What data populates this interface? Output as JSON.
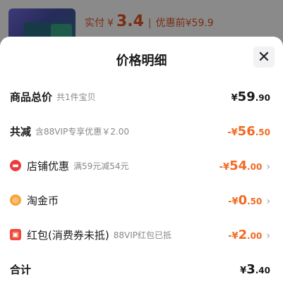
{
  "backdrop": {
    "paid_label": "实付",
    "paid_currency": "¥",
    "paid_amount": "3.4",
    "separator": "|",
    "original_text": "优惠前¥59.9"
  },
  "sheet": {
    "title": "价格明细",
    "close_icon": "close-icon"
  },
  "rows": {
    "total": {
      "label": "商品总价",
      "sub": "共1件宝贝",
      "currency": "¥",
      "int": "59",
      "dec": ".90"
    },
    "discount_total": {
      "label": "共减",
      "sub": "含88VIP专享优惠￥2.00",
      "currency": "-¥",
      "int": "56",
      "dec": ".50"
    },
    "shop_discount": {
      "label": "店铺优惠",
      "sub": "满59元减54元",
      "currency": "-¥",
      "int": "54",
      "dec": ".00"
    },
    "taojinbi": {
      "label": "淘金币",
      "currency": "-¥",
      "int": "0",
      "dec": ".50"
    },
    "red_packet": {
      "label": "红包(消费券未抵)",
      "sub": "88VIP红包已抵",
      "currency": "-¥",
      "int": "2",
      "dec": ".00"
    },
    "sum": {
      "label": "合计",
      "currency": "¥",
      "int": "3",
      "dec": ".40"
    }
  },
  "colors": {
    "accent_orange": "#f26a23",
    "shop_icon": "#ec3b3b",
    "coin_icon": "#f7a43a"
  }
}
